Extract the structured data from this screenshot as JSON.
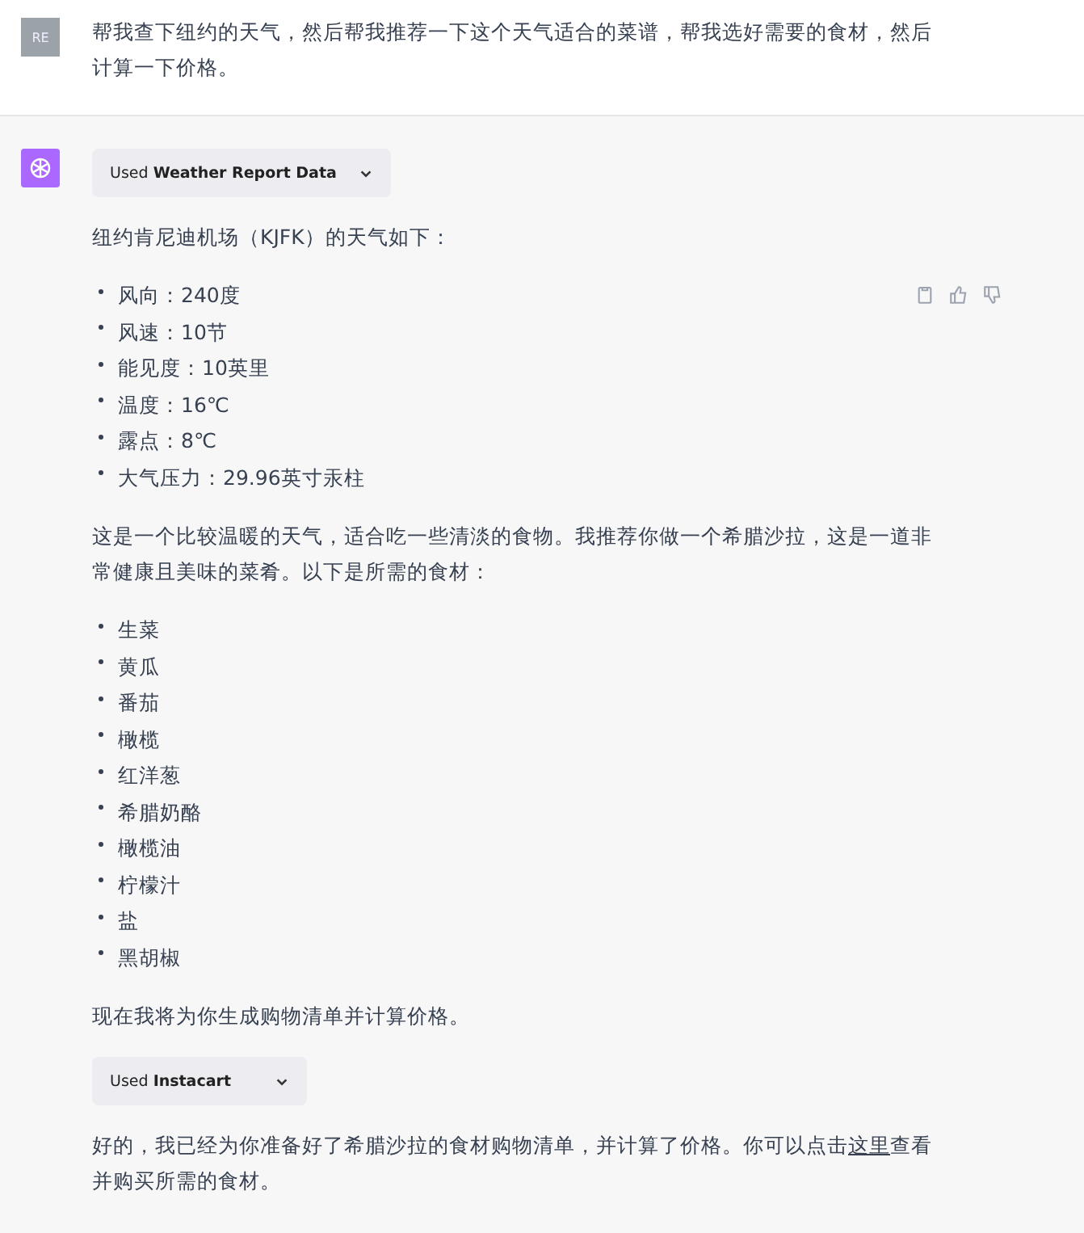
{
  "user_message": {
    "avatar": "RE",
    "text": "帮我查下纽约的天气，然后帮我推荐一下这个天气适合的菜谱，帮我选好需要的食材，然后计算一下价格。"
  },
  "assistant_message": {
    "blocks": [
      {
        "kind": "plugin",
        "label": "Used **Weather Report Data**",
        "expanded": false
      },
      {
        "kind": "paragraph",
        "text": "纽约肯尼迪机场（KJFK）的天气如下："
      },
      {
        "kind": "list",
        "items": [
          "风向：240度",
          "风速：10节",
          "能见度：10英里",
          "温度：16℃",
          "露点：8℃",
          "大气压力：29.96英寸汞柱"
        ]
      },
      {
        "kind": "paragraph",
        "text": "这是一个比较温暖的天气，适合吃一些清淡的食物。我推荐你做一个希腊沙拉，这是一道非常健康且美味的菜肴。以下是所需的食材："
      },
      {
        "kind": "list",
        "items": [
          "生菜",
          "黄瓜",
          "番茄",
          "橄榄",
          "红洋葱",
          "希腊奶酪",
          "橄榄油",
          "柠檬汁",
          "盐",
          "黑胡椒"
        ]
      },
      {
        "kind": "paragraph",
        "text": "现在我将为你生成购物清单并计算价格。"
      },
      {
        "kind": "plugin",
        "label": "Used **Instacart**",
        "expanded": false
      },
      {
        "kind": "link_paragraph",
        "before": "好的，我已经为你准备好了希腊沙拉的食材购物清单，并计算了价格。你可以点击",
        "link": "这里",
        "after": "查看并购买所需的食材。"
      }
    ]
  }
}
